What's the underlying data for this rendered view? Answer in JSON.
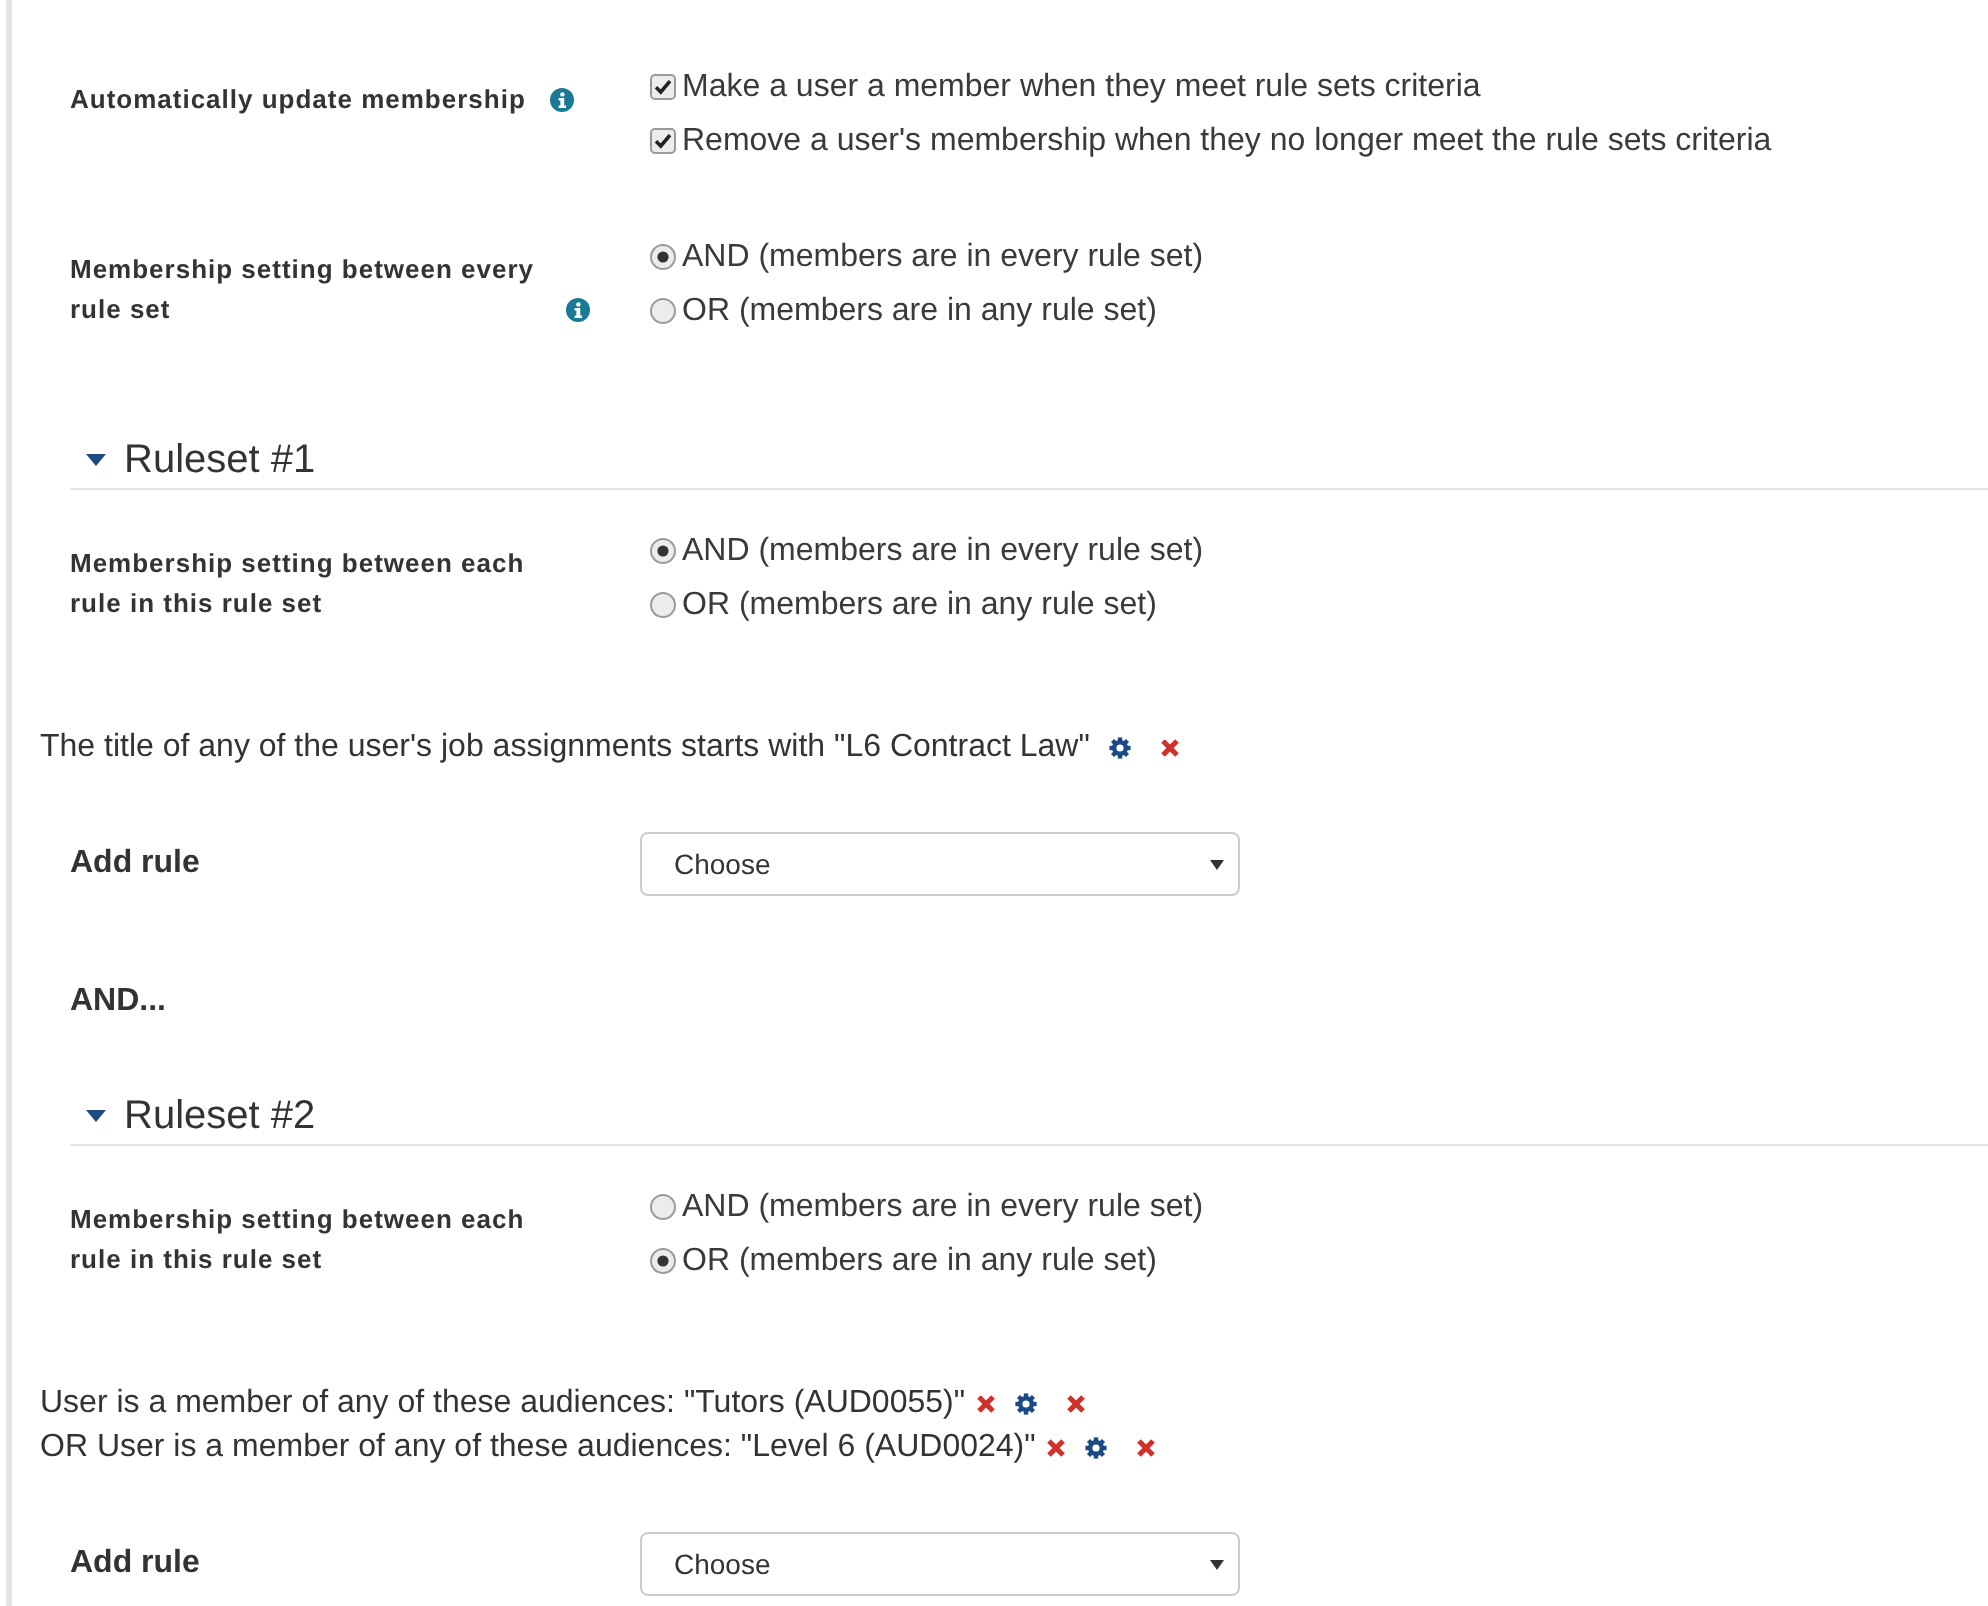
{
  "settings": [
    {
      "label": "Automatically update membership",
      "help": true,
      "kind": "checkbox",
      "options": [
        {
          "label": "Make a user a member when they meet rule sets criteria",
          "checked": true
        },
        {
          "label": "Remove a user's membership when they no longer meet the rule sets criteria",
          "checked": true
        }
      ]
    },
    {
      "label": "Membership setting between every rule set",
      "help": true,
      "kind": "radio",
      "options": [
        {
          "label": "AND (members are in every rule set)",
          "selected": true
        },
        {
          "label": "OR (members are in any rule set)",
          "selected": false
        }
      ]
    }
  ],
  "rulesets": [
    {
      "title": "Ruleset #1",
      "expanded": true,
      "setting": {
        "label": "Membership setting between each rule in this rule set",
        "kind": "radio",
        "options": [
          {
            "label": "AND (members are in every rule set)",
            "selected": true
          },
          {
            "label": "OR (members are in any rule set)",
            "selected": false
          }
        ]
      },
      "rules": [
        {
          "text": "The title of any of the user's job assignments starts with \"L6 Contract Law\"",
          "actions": [
            {
              "kind": "edit"
            },
            {
              "kind": "delete"
            }
          ]
        }
      ],
      "add_rule": {
        "label": "Add rule",
        "value": "Choose"
      },
      "joiner": "AND..."
    },
    {
      "title": "Ruleset #2",
      "expanded": true,
      "setting": {
        "label": "Membership setting between each rule in this rule set",
        "kind": "radio",
        "options": [
          {
            "label": "AND (members are in every rule set)",
            "selected": false
          },
          {
            "label": "OR (members are in any rule set)",
            "selected": true
          }
        ]
      },
      "rules": [
        {
          "text": "User is a member of any of these audiences: \"Tutors (AUD0055)\"",
          "actions": [
            {
              "kind": "remove"
            },
            {
              "kind": "edit"
            },
            {
              "kind": "delete"
            }
          ]
        },
        {
          "text": "OR User is a member of any of these audiences: \"Level 6 (AUD0024)\"",
          "actions": [
            {
              "kind": "remove"
            },
            {
              "kind": "edit"
            },
            {
              "kind": "delete"
            }
          ]
        }
      ],
      "add_rule": {
        "label": "Add rule",
        "value": "Choose"
      }
    }
  ]
}
